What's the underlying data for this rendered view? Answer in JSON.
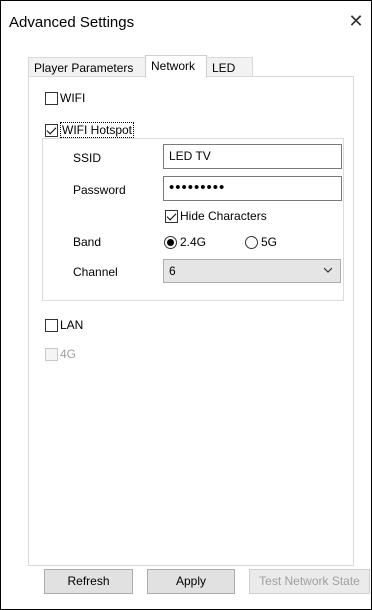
{
  "window": {
    "title": "Advanced Settings",
    "close_glyph": "✕"
  },
  "tabs": [
    {
      "label": "Player Parameters",
      "active": false
    },
    {
      "label": "Network",
      "active": true
    },
    {
      "label": "LED",
      "active": false
    }
  ],
  "network": {
    "wifi": {
      "label": "WIFI",
      "checked": false
    },
    "wifi_hotspot": {
      "label": "WIFI Hotspot",
      "checked": true
    },
    "ssid": {
      "label": "SSID",
      "value": "LED TV"
    },
    "password": {
      "label": "Password",
      "value": "•••••••••"
    },
    "hide_characters": {
      "label": "Hide Characters",
      "checked": true
    },
    "band": {
      "label": "Band",
      "options": [
        "2.4G",
        "5G"
      ],
      "selected": "2.4G"
    },
    "channel": {
      "label": "Channel",
      "value": "6"
    },
    "lan": {
      "label": "LAN",
      "checked": false
    },
    "fourg": {
      "label": "4G",
      "checked": false,
      "disabled": true
    }
  },
  "buttons": {
    "refresh": "Refresh",
    "apply": "Apply",
    "test_network_state": "Test Network State"
  }
}
